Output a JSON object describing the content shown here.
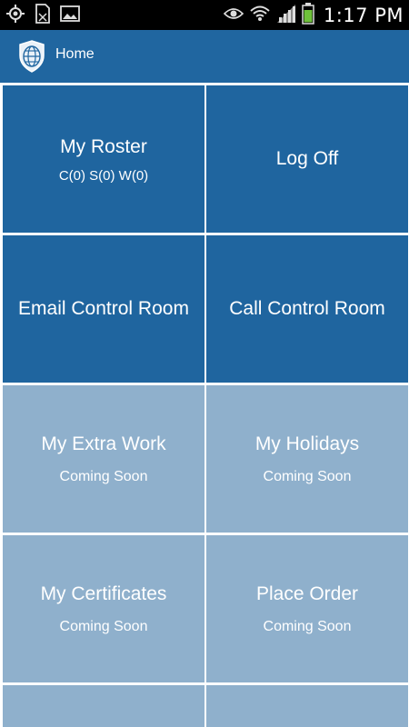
{
  "status_bar": {
    "time": "1:17 PM",
    "left_icons": [
      "gps-icon",
      "sim-card-icon",
      "image-icon"
    ],
    "right_icons": [
      "eye-icon",
      "wifi-icon",
      "signal-icon",
      "battery-icon"
    ]
  },
  "app_bar": {
    "title": "Home",
    "logo_icon": "shield-globe-icon"
  },
  "tiles": [
    {
      "title": "My Roster",
      "subtitle": "C(0) S(0) W(0)",
      "state": "active"
    },
    {
      "title": "Log Off",
      "subtitle": "",
      "state": "active"
    },
    {
      "title": "Email Control Room",
      "subtitle": "",
      "state": "active"
    },
    {
      "title": "Call Control Room",
      "subtitle": "",
      "state": "active"
    },
    {
      "title": "My Extra Work",
      "subtitle": "Coming Soon",
      "state": "soon"
    },
    {
      "title": "My Holidays",
      "subtitle": "Coming Soon",
      "state": "soon"
    },
    {
      "title": "My Certificates",
      "subtitle": "Coming Soon",
      "state": "soon"
    },
    {
      "title": "Place Order",
      "subtitle": "Coming Soon",
      "state": "soon"
    },
    {
      "title": "",
      "subtitle": "",
      "state": "soon"
    },
    {
      "title": "",
      "subtitle": "",
      "state": "soon"
    }
  ],
  "colors": {
    "app_bar": "#2066a0",
    "tile_active": "#1f659f",
    "tile_coming_soon": "#8fb0cc",
    "status_bar": "#000000",
    "battery_level": "#6fc13b"
  }
}
